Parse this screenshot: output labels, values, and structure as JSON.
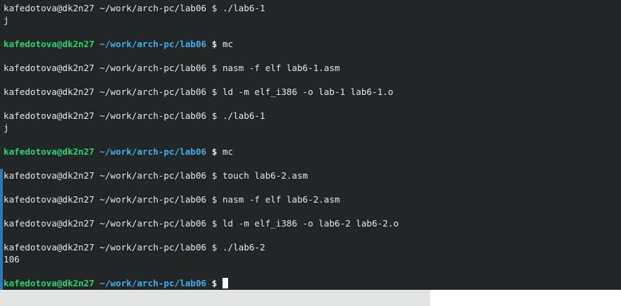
{
  "terminal": {
    "colors": {
      "background": "#232627",
      "text": "#e4e6e7",
      "user_host": "#1fd66b",
      "path": "#3daee9",
      "selection_bar": "#2a78c2",
      "cursor": "#fcfcfc"
    },
    "lines": [
      {
        "kind": "prompt",
        "user": "kafedotova@dk2n27",
        "path": "~/work/arch-pc/lab06",
        "symbol": "$",
        "command": "./lab6-1"
      },
      {
        "kind": "output",
        "text": "j"
      },
      {
        "kind": "blank"
      },
      {
        "kind": "prompt_color",
        "user": "kafedotova@dk2n27",
        "path": "~/work/arch-pc/lab06",
        "symbol": "$",
        "command": "mc"
      },
      {
        "kind": "blank"
      },
      {
        "kind": "prompt",
        "user": "kafedotova@dk2n27",
        "path": "~/work/arch-pc/lab06",
        "symbol": "$",
        "command": "nasm -f elf lab6-1.asm"
      },
      {
        "kind": "blank"
      },
      {
        "kind": "prompt",
        "user": "kafedotova@dk2n27",
        "path": "~/work/arch-pc/lab06",
        "symbol": "$",
        "command": "ld -m elf_i386 -o lab-1 lab6-1.o"
      },
      {
        "kind": "blank"
      },
      {
        "kind": "prompt",
        "user": "kafedotova@dk2n27",
        "path": "~/work/arch-pc/lab06",
        "symbol": "$",
        "command": "./lab6-1"
      },
      {
        "kind": "output",
        "text": "j"
      },
      {
        "kind": "blank"
      },
      {
        "kind": "prompt_color",
        "user": "kafedotova@dk2n27",
        "path": "~/work/arch-pc/lab06",
        "symbol": "$",
        "command": "mc"
      },
      {
        "kind": "blank"
      },
      {
        "kind": "prompt",
        "user": "kafedotova@dk2n27",
        "path": "~/work/arch-pc/lab06",
        "symbol": "$",
        "command": "touch lab6-2.asm"
      },
      {
        "kind": "blank"
      },
      {
        "kind": "prompt",
        "user": "kafedotova@dk2n27",
        "path": "~/work/arch-pc/lab06",
        "symbol": "$",
        "command": "nasm -f elf lab6-2.asm"
      },
      {
        "kind": "blank"
      },
      {
        "kind": "prompt",
        "user": "kafedotova@dk2n27",
        "path": "~/work/arch-pc/lab06",
        "symbol": "$",
        "command": "ld -m elf_i386 -o lab6-2 lab6-2.o"
      },
      {
        "kind": "blank"
      },
      {
        "kind": "prompt",
        "user": "kafedotova@dk2n27",
        "path": "~/work/arch-pc/lab06",
        "symbol": "$",
        "command": "./lab6-2"
      },
      {
        "kind": "output",
        "text": "106"
      },
      {
        "kind": "blank"
      },
      {
        "kind": "prompt_active",
        "user": "kafedotova@dk2n27",
        "path": "~/work/arch-pc/lab06",
        "symbol": "$",
        "command": ""
      }
    ]
  }
}
